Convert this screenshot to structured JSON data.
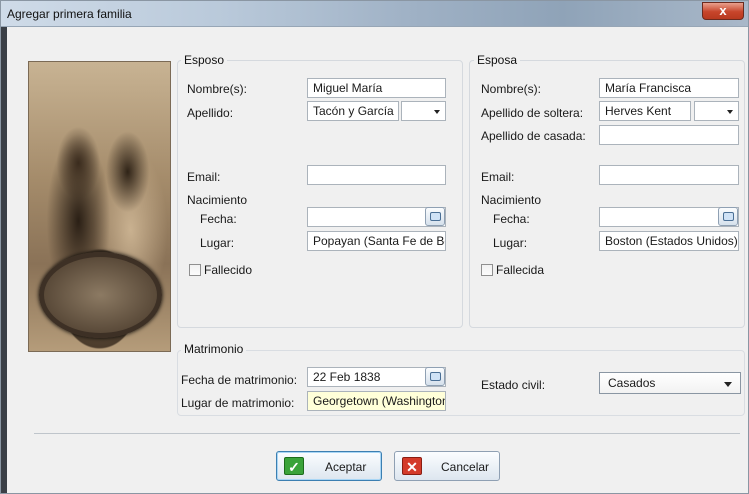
{
  "window": {
    "title": "Agregar primera familia",
    "close_label": "x"
  },
  "esposo": {
    "legend": "Esposo",
    "nombre_label": "Nombre(s):",
    "nombre_value": "Miguel María",
    "apellido_label": "Apellido:",
    "apellido_value": "Tacón y García",
    "email_label": "Email:",
    "email_value": "",
    "nacimiento_label": "Nacimiento",
    "fecha_label": "Fecha:",
    "fecha_value": "",
    "lugar_label": "Lugar:",
    "lugar_value": "Popayan (Santa Fe de Bogotá",
    "fallecido_label": "Fallecido",
    "fallecido_checked": false
  },
  "esposa": {
    "legend": "Esposa",
    "nombre_label": "Nombre(s):",
    "nombre_value": "María Francisca",
    "apellido_soltera_label": "Apellido de soltera:",
    "apellido_soltera_value": "Herves Kent",
    "apellido_casada_label": "Apellido de casada:",
    "apellido_casada_value": "",
    "email_label": "Email:",
    "email_value": "",
    "nacimiento_label": "Nacimiento",
    "fecha_label": "Fecha:",
    "fecha_value": "",
    "lugar_label": "Lugar:",
    "lugar_value": "Boston (Estados Unidos)",
    "fallecida_label": "Fallecida",
    "fallecida_checked": false
  },
  "matrimonio": {
    "legend": "Matrimonio",
    "fecha_label": "Fecha de matrimonio:",
    "fecha_value": "22 Feb 1838",
    "lugar_label": "Lugar de matrimonio:",
    "lugar_value": "Georgetown (Washington",
    "estado_label": "Estado civil:",
    "estado_value": "Casados"
  },
  "buttons": {
    "aceptar_label": "Aceptar",
    "cancelar_label": "Cancelar"
  },
  "colors": {
    "accent_ok": "#3aa33a",
    "accent_cancel": "#d43b2a",
    "highlight_field": "#ffffd9"
  }
}
